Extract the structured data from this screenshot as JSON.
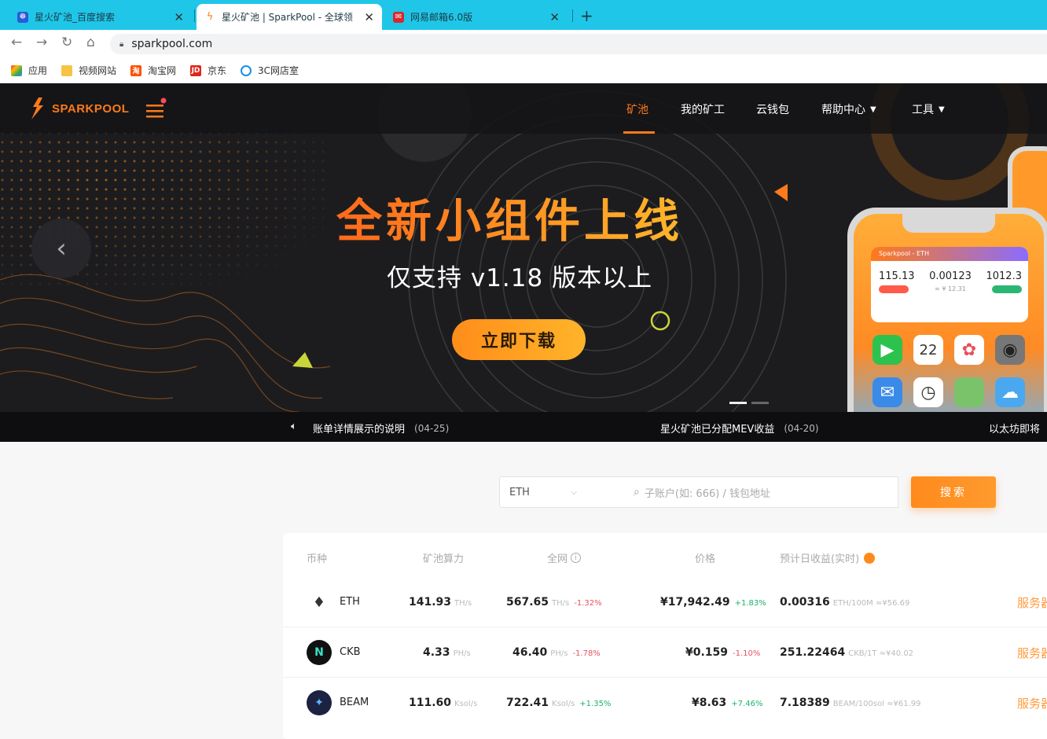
{
  "browser": {
    "tabs": [
      {
        "title": "星火矿池_百度搜索",
        "active": false
      },
      {
        "title": "星火矿池 | SparkPool - 全球领",
        "active": true
      },
      {
        "title": "网易邮箱6.0版",
        "active": false
      }
    ],
    "new_tab": "+",
    "close": "✕",
    "url": "sparkpool.com",
    "bookmarks": [
      {
        "label": "应用",
        "icon": "apps-grid-icon"
      },
      {
        "label": "视频网站",
        "icon": "folder-icon"
      },
      {
        "label": "淘宝网",
        "icon": "taobao-icon"
      },
      {
        "label": "京东",
        "icon": "jd-icon"
      },
      {
        "label": "3C网店室",
        "icon": "link-icon"
      }
    ]
  },
  "site": {
    "logo": "SPARKPOOL",
    "nav": [
      {
        "label": "矿池",
        "active": true,
        "dropdown": false
      },
      {
        "label": "我的矿工",
        "active": false,
        "dropdown": false
      },
      {
        "label": "云钱包",
        "active": false,
        "dropdown": false
      },
      {
        "label": "帮助中心",
        "active": false,
        "dropdown": true
      },
      {
        "label": "工具",
        "active": false,
        "dropdown": true
      }
    ]
  },
  "banner": {
    "headline": "全新小组件上线",
    "subline": "仅支持 v1.18 版本以上",
    "button": "立即下载",
    "prev": "‹",
    "widget": {
      "title": "Sparkpool - ETH",
      "values": [
        "115.13",
        "0.00123",
        "1012.3"
      ],
      "sub": "≈ ¥ 12.31",
      "calendar_day": "22"
    },
    "slide_active": 0,
    "slide_count": 2
  },
  "ticker": [
    {
      "text": "账单详情展示的说明",
      "date": "(04-25)"
    },
    {
      "text": "星火矿池已分配MEV收益",
      "date": "(04-20)"
    },
    {
      "text": "以太坊即将",
      "date": ""
    }
  ],
  "search": {
    "coin": "ETH",
    "placeholder": "子账户(如: 666) / 钱包地址",
    "button": "搜索"
  },
  "table": {
    "headers": [
      "币种",
      "矿池算力",
      "全网",
      "价格",
      "预计日收益(实时)"
    ],
    "rows": [
      {
        "coin": "ETH",
        "pool": "141.93",
        "pool_unit": "TH/s",
        "net": "567.65",
        "net_unit": "TH/s",
        "net_change": "-1.32%",
        "net_dir": "neg",
        "price": "¥17,942.49",
        "price_change": "+1.83%",
        "price_dir": "pos",
        "income": "0.00316",
        "income_unit": "ETH/100M ≈¥56.69",
        "service": "服务器",
        "icon_color": "#ffffff"
      },
      {
        "coin": "CKB",
        "pool": "4.33",
        "pool_unit": "PH/s",
        "net": "46.40",
        "net_unit": "PH/s",
        "net_change": "-1.78%",
        "net_dir": "neg",
        "price": "¥0.159",
        "price_change": "-1.10%",
        "price_dir": "neg",
        "income": "251.22464",
        "income_unit": "CKB/1T ≈¥40.02",
        "service": "服务器",
        "icon_color": "#111111"
      },
      {
        "coin": "BEAM",
        "pool": "111.60",
        "pool_unit": "Ksol/s",
        "net": "722.41",
        "net_unit": "Ksol/s",
        "net_change": "+1.35%",
        "net_dir": "pos",
        "price": "¥8.63",
        "price_change": "+7.46%",
        "price_dir": "pos",
        "income": "7.18389",
        "income_unit": "BEAM/100sol ≈¥61.99",
        "service": "服务器",
        "icon_color": "#1b2340"
      }
    ]
  },
  "colors": {
    "accent": "#ff7a1a",
    "tabstrip": "#1fc6e8",
    "positive": "#1bb36a",
    "negative": "#e8505b"
  }
}
